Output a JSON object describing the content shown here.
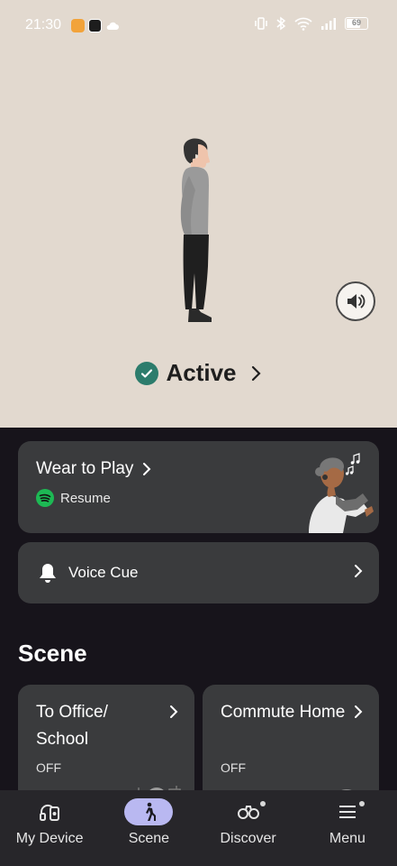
{
  "status_bar": {
    "time": "21:30",
    "battery": "69"
  },
  "hero": {
    "status_label": "Active",
    "sound_button_icon": "speaker-icon"
  },
  "wear_to_play": {
    "title": "Wear to Play",
    "service": "Resume"
  },
  "voice_cue": {
    "label": "Voice Cue"
  },
  "scene": {
    "heading": "Scene",
    "cards": [
      {
        "title": "To Office/ School",
        "state": "OFF"
      },
      {
        "title": "Commute Home",
        "state": "OFF"
      }
    ]
  },
  "nav": {
    "items": [
      {
        "label": "My Device",
        "icon": "headphones-device-icon"
      },
      {
        "label": "Scene",
        "icon": "walking-person-icon",
        "active": true
      },
      {
        "label": "Discover",
        "icon": "binoculars-icon"
      },
      {
        "label": "Menu",
        "icon": "menu-icon"
      }
    ]
  },
  "colors": {
    "hero_bg": "#e2d9cf",
    "page_bg": "#17141b",
    "card_bg": "#3a3b3d",
    "accent_check": "#2c7c6c",
    "nav_active": "#b9b8f1",
    "spotify_green": "#1db954"
  }
}
